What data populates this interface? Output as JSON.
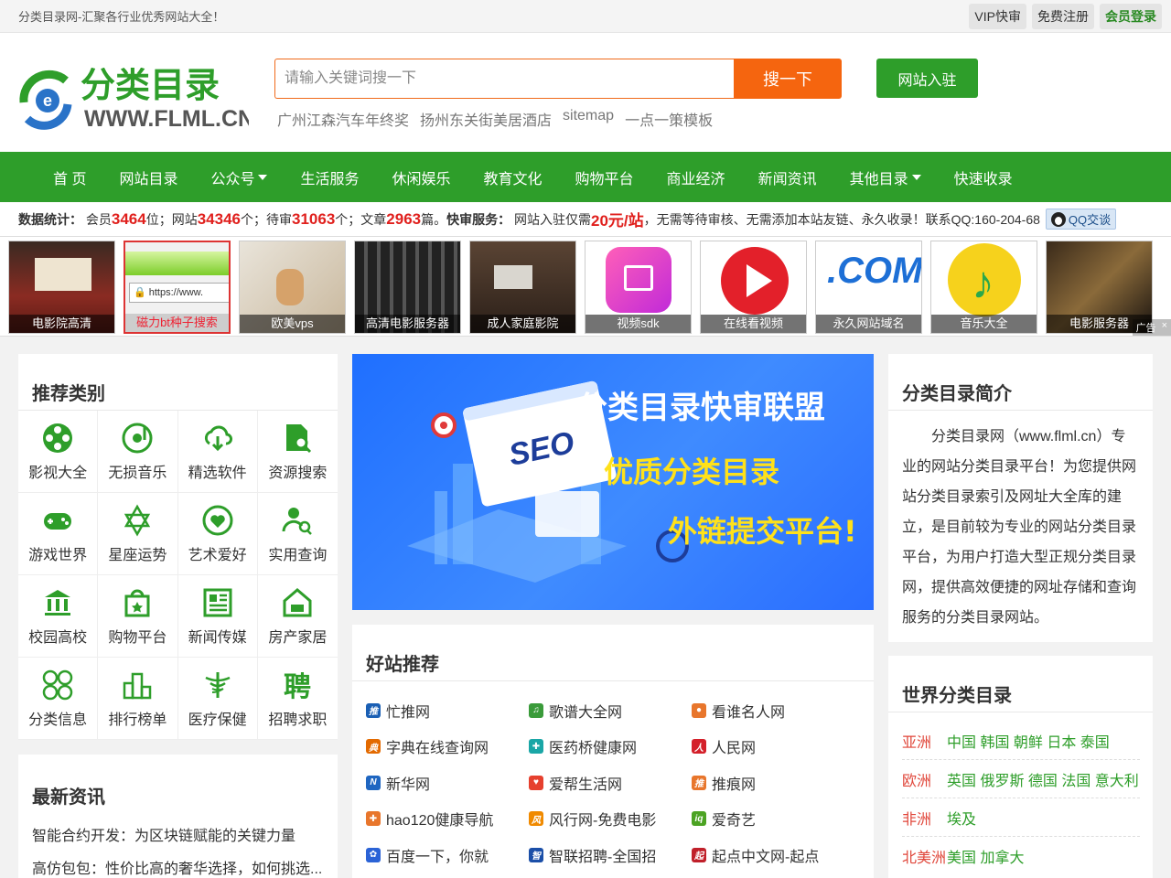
{
  "topbar": {
    "slogan": "分类目录网-汇聚各行业优秀网站大全！",
    "vip": "VIP快审",
    "register": "免费注册",
    "login": "会员登录"
  },
  "header": {
    "logo_text": "分类目录",
    "logo_url": "WWW.FLML.CN",
    "search_placeholder": "请输入关键词搜一下",
    "search_button": "搜一下",
    "join_button": "网站入驻",
    "hotwords": [
      "广州江森汽车年终奖",
      "扬州东关街美居酒店",
      "sitemap",
      "一点一策模板"
    ]
  },
  "nav": {
    "items": [
      {
        "label": "首 页",
        "dropdown": false
      },
      {
        "label": "网站目录",
        "dropdown": false
      },
      {
        "label": "公众号",
        "dropdown": true
      },
      {
        "label": "生活服务",
        "dropdown": false
      },
      {
        "label": "休闲娱乐",
        "dropdown": false
      },
      {
        "label": "教育文化",
        "dropdown": false
      },
      {
        "label": "购物平台",
        "dropdown": false
      },
      {
        "label": "商业经济",
        "dropdown": false
      },
      {
        "label": "新闻资讯",
        "dropdown": false
      },
      {
        "label": "其他目录",
        "dropdown": true
      },
      {
        "label": "快速收录",
        "dropdown": false
      }
    ]
  },
  "stats": {
    "label": "数据统计：",
    "t1": "会员",
    "members": "3464",
    "t2": "位；网站",
    "sites": "34346",
    "t3": "个；待审",
    "pending": "31063",
    "t4": "个；文章",
    "articles": "2963",
    "t5": "篇。",
    "service_label": "快审服务：",
    "t6": "网站入驻仅需",
    "price": "20元/站",
    "t7": "，无需等待审核、无需添加本站友链、永久收录！联系QQ:160-204-68",
    "qq_button": "QQ交谈"
  },
  "strip": {
    "items": [
      "电影院高清",
      "磁力bt种子搜索",
      "欧美vps",
      "高清电影服务器",
      "成人家庭影院",
      "视频sdk",
      "在线看视频",
      "永久网站域名",
      "音乐大全",
      "电影服务器"
    ],
    "ad_label": "广告",
    "ad_close": "×"
  },
  "categories": {
    "title": "推荐类别",
    "items": [
      {
        "label": "影视大全",
        "icon": "film-reel-icon"
      },
      {
        "label": "无损音乐",
        "icon": "music-disc-icon"
      },
      {
        "label": "精选软件",
        "icon": "cloud-download-icon"
      },
      {
        "label": "资源搜索",
        "icon": "file-search-icon"
      },
      {
        "label": "游戏世界",
        "icon": "gamepad-icon"
      },
      {
        "label": "星座运势",
        "icon": "star-icon"
      },
      {
        "label": "艺术爱好",
        "icon": "heart-icon"
      },
      {
        "label": "实用查询",
        "icon": "user-search-icon"
      },
      {
        "label": "校园高校",
        "icon": "school-icon"
      },
      {
        "label": "购物平台",
        "icon": "shopping-bag-icon"
      },
      {
        "label": "新闻传媒",
        "icon": "newspaper-icon"
      },
      {
        "label": "房产家居",
        "icon": "house-icon"
      },
      {
        "label": "分类信息",
        "icon": "grid-circles-icon"
      },
      {
        "label": "排行榜单",
        "icon": "podium-icon"
      },
      {
        "label": "医疗保健",
        "icon": "caduceus-icon"
      },
      {
        "label": "招聘求职",
        "icon": "recruit-icon"
      }
    ]
  },
  "news": {
    "title": "最新资讯",
    "items": [
      "智能合约开发：为区块链赋能的关键力量",
      "高仿包包：性价比高的奢华选择，如何挑选..."
    ]
  },
  "banner": {
    "line1": "分类目录快审联盟",
    "line2": "优质分类目录",
    "line3": "外链提交平台!",
    "seo": "SEO"
  },
  "good_sites": {
    "title": "好站推荐",
    "items": [
      {
        "label": "忙推网",
        "color": "#1a5fb4",
        "glyph": "推"
      },
      {
        "label": "歌谱大全网",
        "color": "#3a9b3a",
        "glyph": "♫"
      },
      {
        "label": "看谁名人网",
        "color": "#e8762c",
        "glyph": "●"
      },
      {
        "label": "字典在线查询网",
        "color": "#e36a00",
        "glyph": "典"
      },
      {
        "label": "医药桥健康网",
        "color": "#1aa6a6",
        "glyph": "✚"
      },
      {
        "label": "人民网",
        "color": "#d4202a",
        "glyph": "人"
      },
      {
        "label": "新华网",
        "color": "#1f66c1",
        "glyph": "N"
      },
      {
        "label": "爱帮生活网",
        "color": "#e6402e",
        "glyph": "♥"
      },
      {
        "label": "推痕网",
        "color": "#e8762c",
        "glyph": "推"
      },
      {
        "label": "hao120健康导航",
        "color": "#e8762c",
        "glyph": "✚"
      },
      {
        "label": "风行网-免费电影",
        "color": "#f08a00",
        "glyph": "风"
      },
      {
        "label": "爱奇艺",
        "color": "#4ca323",
        "glyph": "iq"
      },
      {
        "label": "百度一下，你就",
        "color": "#2b63d6",
        "glyph": "✿"
      },
      {
        "label": "智联招聘-全国招",
        "color": "#1b4fa8",
        "glyph": "智"
      },
      {
        "label": "起点中文网-起点",
        "color": "#c0202a",
        "glyph": "起"
      }
    ]
  },
  "intro": {
    "title": "分类目录简介",
    "text": "分类目录网（www.flml.cn）专业的网站分类目录平台！为您提供网站分类目录索引及网址大全库的建立，是目前较为专业的网站分类目录平台，为用户打造大型正规分类目录网，提供高效便捷的网址存储和查询服务的分类目录网站。"
  },
  "world": {
    "title": "世界分类目录",
    "rows": [
      {
        "continent": "亚洲",
        "countries": "中国 韩国 朝鲜 日本 泰国"
      },
      {
        "continent": "欧洲",
        "countries": "英国 俄罗斯 德国 法国 意大利"
      },
      {
        "continent": "非洲",
        "countries": "埃及"
      },
      {
        "continent": "北美洲",
        "countries": "美国 加拿大"
      }
    ]
  },
  "colors": {
    "brand_green": "#2e9e2a",
    "accent_orange": "#f5650f",
    "stat_red": "#e0201d"
  }
}
